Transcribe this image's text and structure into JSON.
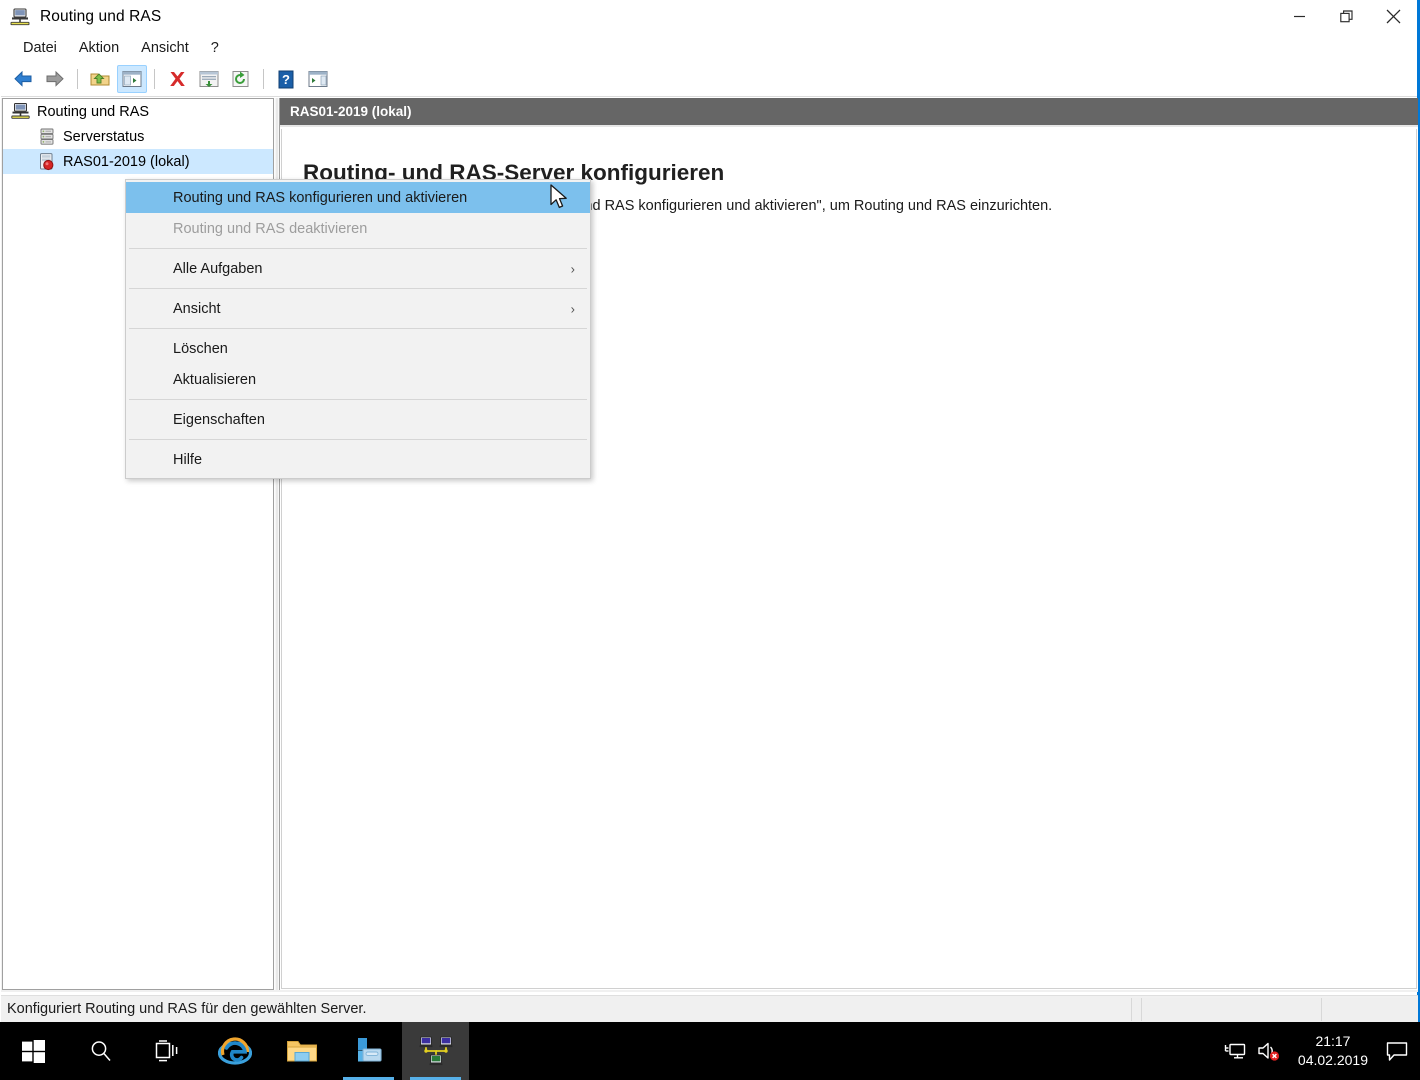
{
  "window": {
    "title": "Routing und RAS",
    "icon": "routing-ras-icon",
    "accent_color": "#0078d7",
    "controls": {
      "minimize": "minimize-button",
      "restore": "restore-button",
      "close": "close-button"
    }
  },
  "menu_bar": {
    "items": [
      {
        "label": "Datei",
        "name": "menu-datei"
      },
      {
        "label": "Aktion",
        "name": "menu-aktion"
      },
      {
        "label": "Ansicht",
        "name": "menu-ansicht"
      },
      {
        "label": "?",
        "name": "menu-help"
      }
    ]
  },
  "toolbar": {
    "buttons": [
      {
        "name": "back-button",
        "icon": "arrow-left-icon",
        "pressed": false
      },
      {
        "name": "forward-button",
        "icon": "arrow-right-icon",
        "pressed": false
      },
      {
        "name": "up-one-level-button",
        "icon": "folder-up-icon",
        "pressed": false
      },
      {
        "name": "show-hide-console-tree-button",
        "icon": "console-tree-icon",
        "pressed": true
      },
      {
        "name": "delete-button",
        "icon": "red-x-icon",
        "pressed": false
      },
      {
        "name": "export-list-button",
        "icon": "export-list-icon",
        "pressed": false
      },
      {
        "name": "refresh-button",
        "icon": "refresh-icon",
        "pressed": false
      },
      {
        "name": "help-button",
        "icon": "question-mark-icon",
        "pressed": false
      },
      {
        "name": "show-hide-action-pane-button",
        "icon": "action-pane-icon",
        "pressed": false
      }
    ]
  },
  "tree": {
    "nodes": [
      {
        "label": "Routing und RAS",
        "icon": "routing-ras-root-icon",
        "indent": 0,
        "selected": false
      },
      {
        "label": "Serverstatus",
        "icon": "server-status-icon",
        "indent": 1,
        "selected": false
      },
      {
        "label": "RAS01-2019 (lokal)",
        "icon": "server-stopped-icon",
        "indent": 1,
        "selected": true
      }
    ]
  },
  "content": {
    "header_title": "RAS01-2019 (lokal)",
    "heading": "Routing- und RAS-Server konfigurieren",
    "paragraph": "Klicken Sie im Menü \"Aktion\" auf \"Routing und RAS konfigurieren und aktivieren\", um Routing und RAS einzurichten."
  },
  "context_menu": {
    "items": [
      {
        "label": "Routing und RAS konfigurieren und aktivieren",
        "name": "ctx-configure-enable",
        "state": "highlight",
        "submenu": false
      },
      {
        "label": "Routing und RAS deaktivieren",
        "name": "ctx-disable",
        "state": "disabled",
        "submenu": false
      },
      {
        "separator": true
      },
      {
        "label": "Alle Aufgaben",
        "name": "ctx-all-tasks",
        "state": "normal",
        "submenu": true
      },
      {
        "separator": true
      },
      {
        "label": "Ansicht",
        "name": "ctx-view",
        "state": "normal",
        "submenu": true
      },
      {
        "separator": true
      },
      {
        "label": "Löschen",
        "name": "ctx-delete",
        "state": "normal",
        "submenu": false
      },
      {
        "label": "Aktualisieren",
        "name": "ctx-refresh",
        "state": "normal",
        "submenu": false
      },
      {
        "separator": true
      },
      {
        "label": "Eigenschaften",
        "name": "ctx-properties",
        "state": "normal",
        "submenu": false
      },
      {
        "separator": true
      },
      {
        "label": "Hilfe",
        "name": "ctx-help",
        "state": "normal",
        "submenu": false
      }
    ],
    "submenu_arrow": "›"
  },
  "status_bar": {
    "text": "Konfiguriert Routing und RAS für den gewählten Server.",
    "panes": [
      "",
      "",
      ""
    ]
  },
  "taskbar": {
    "items": [
      {
        "name": "start-button",
        "icon": "windows-logo-icon",
        "active": false,
        "running": false
      },
      {
        "name": "search-button",
        "icon": "search-icon",
        "active": false,
        "running": false
      },
      {
        "name": "task-view-button",
        "icon": "task-view-icon",
        "active": false,
        "running": false
      },
      {
        "name": "internet-explorer-button",
        "icon": "internet-explorer-icon",
        "active": false,
        "running": false
      },
      {
        "name": "file-explorer-button",
        "icon": "file-explorer-icon",
        "active": false,
        "running": false
      },
      {
        "name": "server-manager-button",
        "icon": "server-manager-icon",
        "active": false,
        "running": true
      },
      {
        "name": "routing-and-ras-button",
        "icon": "routing-ras-taskbar-icon",
        "active": true,
        "running": true
      }
    ],
    "tray": [
      {
        "name": "network-icon",
        "icon": "network-icon"
      },
      {
        "name": "volume-muted-icon",
        "icon": "volume-muted-icon"
      }
    ],
    "clock": {
      "time": "21:17",
      "date": "04.02.2019"
    },
    "action_center": "action-center-icon"
  }
}
